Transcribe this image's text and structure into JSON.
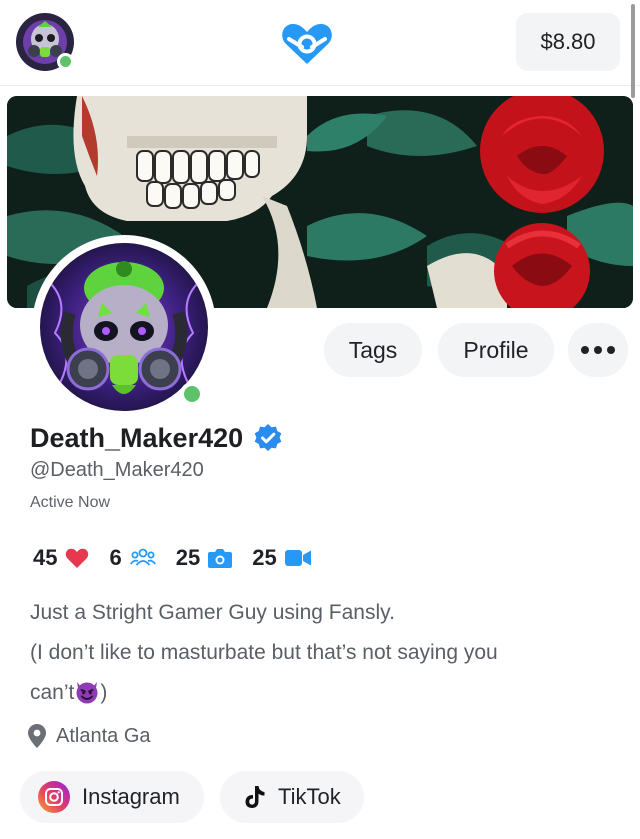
{
  "header": {
    "balance": "$8.80"
  },
  "profile": {
    "buttons": {
      "tags": "Tags",
      "profile": "Profile"
    },
    "display_name": "Death_Maker420",
    "handle": "@Death_Maker420",
    "status": "Active Now",
    "stats": {
      "likes": "45",
      "subscribers": "6",
      "photos": "25",
      "videos": "25"
    },
    "bio": {
      "line1": "Just a  Stright Gamer Guy using Fansly.",
      "line2": "(I don’t like to masturbate but that’s not saying you",
      "line3_before": "can’t",
      "line3_after": ")"
    },
    "location": "Atlanta Ga",
    "socials": [
      {
        "label": "Instagram",
        "icon": "instagram-icon"
      },
      {
        "label": "TikTok",
        "icon": "tiktok-icon"
      }
    ]
  },
  "colors": {
    "accent_blue": "#2699f7",
    "online_green": "#5dc26a",
    "heart_red": "#e8384f",
    "verified_blue": "#2b8cf0"
  }
}
